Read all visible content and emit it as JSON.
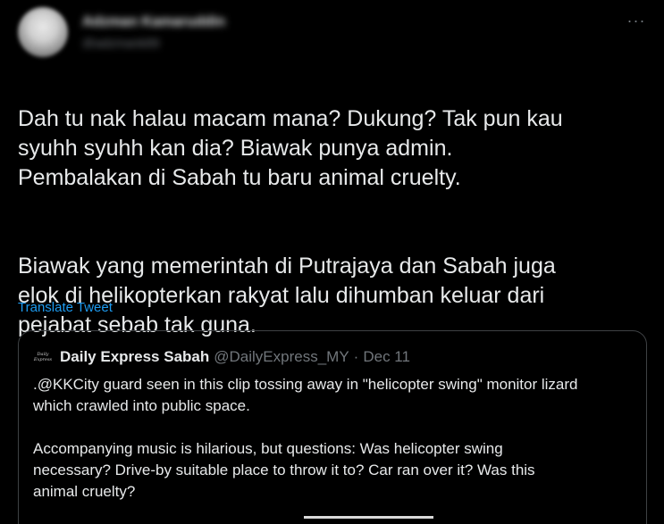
{
  "author": {
    "display_name": "Adzman Kamaruddin",
    "handle": "@adzmank89"
  },
  "more_icon": "more-horizontal-icon",
  "tweet": {
    "paragraph_1": "Dah tu nak halau macam mana? Dukung? Tak pun kau\nsyuhh syuhh kan dia? Biawak punya admin.\nPembalakan di Sabah tu baru animal cruelty.",
    "paragraph_2": "Biawak yang memerintah di Putrajaya dan Sabah juga\nelok di helikopterkan rakyat lalu dihumban keluar dari\npejabat sebab tak guna.",
    "translate_label": "Translate Tweet"
  },
  "quote": {
    "logo_line_1": "Daily",
    "logo_line_2": "Express",
    "name": "Daily Express Sabah",
    "handle": "@DailyExpress_MY",
    "separator": "·",
    "date": "Dec 11",
    "paragraph_1": ".@KKCity guard seen in this clip tossing away in \"helicopter swing\" monitor lizard\nwhich crawled into public space.",
    "paragraph_2": "Accompanying music is hilarious, but questions: Was helicopter swing\nnecessary? Drive-by suitable place to throw it to? Car ran over it? Was this\nanimal cruelty?"
  },
  "colors": {
    "background": "#000000",
    "text": "#e7e9ea",
    "muted": "#71767b",
    "link": "#1d9bf0",
    "border": "#3e4144"
  }
}
